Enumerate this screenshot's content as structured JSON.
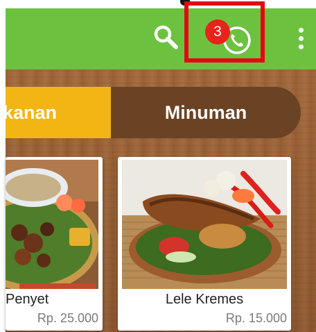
{
  "toolbar": {
    "background": "#6cc23f",
    "search_icon": "search-icon",
    "phone_icon": "phone-icon",
    "more_icon": "more-vert-icon",
    "notification_count": "3",
    "highlight_color": "#e30613"
  },
  "tabs": [
    {
      "label": "kanan",
      "active": true,
      "color": "#f3b514"
    },
    {
      "label": "Minuman",
      "active": false,
      "color": "#6a4324"
    }
  ],
  "menu_items": [
    {
      "name": "Penyet",
      "price": "Rp. 25.000"
    },
    {
      "name": "Lele Kremes",
      "price": "Rp. 15.000"
    }
  ]
}
